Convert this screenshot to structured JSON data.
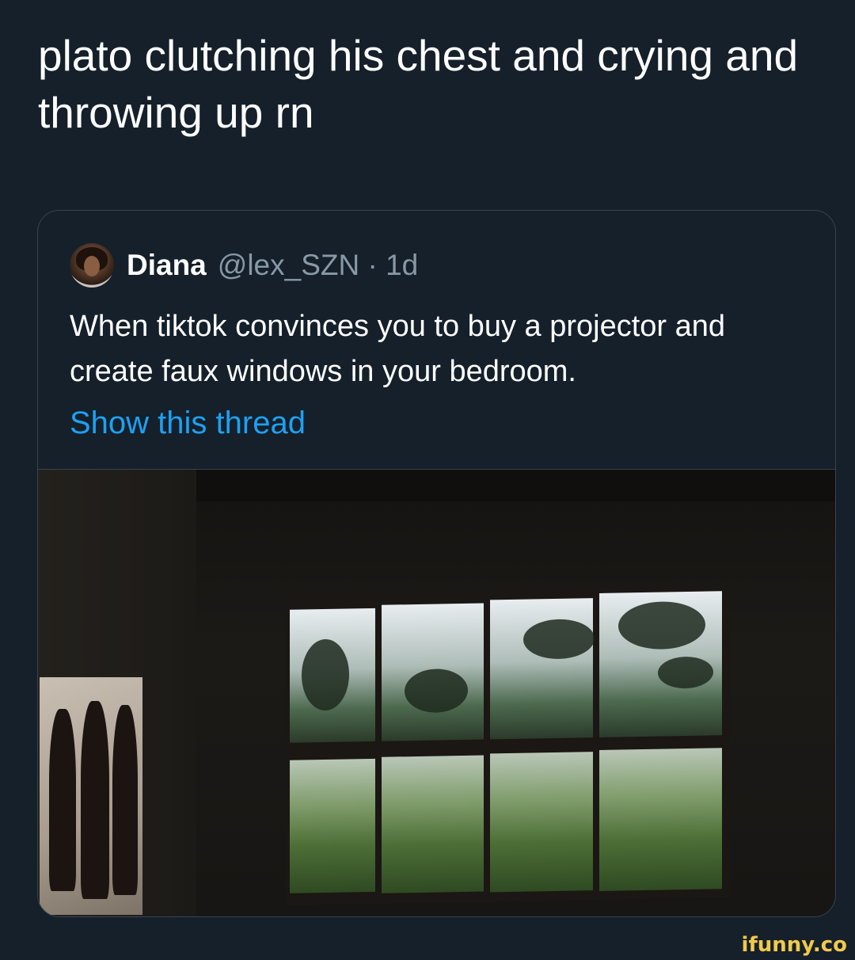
{
  "tweet": {
    "text": "plato clutching his chest and crying and throwing up rn"
  },
  "quote": {
    "name": "Diana",
    "handle_time": "@lex_SZN · 1d",
    "text": "When tiktok convinces you to buy a projector and create faux windows in your bedroom.",
    "show_thread": "Show this thread"
  },
  "watermark": "ifunny.co",
  "colors": {
    "background": "#15202b",
    "link": "#1da1f2",
    "secondary_text": "#8899a6",
    "border": "#38444d"
  }
}
